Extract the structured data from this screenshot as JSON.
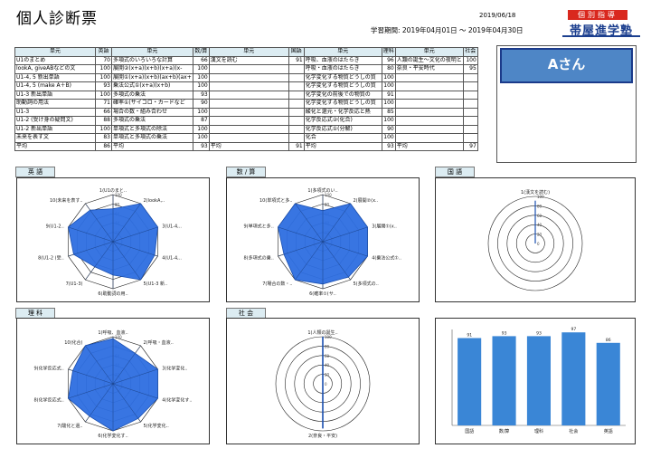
{
  "header": {
    "title": "個人診断票",
    "date": "2019/06/18",
    "period": "学習期間: 2019年04月01日 ～ 2019年04月30日",
    "logo_top": "個別指導",
    "logo_main": "帯屋進学塾"
  },
  "student": {
    "name": "Aさん"
  },
  "table": {
    "headers": [
      "単元",
      "英語",
      "単元",
      "数/算",
      "単元",
      "国語",
      "単元",
      "理科",
      "単元",
      "社会"
    ],
    "rows": [
      [
        "U1のまとめ",
        "70",
        "多項式のいろいろな計算",
        "66",
        "漢文を読む",
        "91",
        "呼吸、血液のはたらき",
        "96",
        "人類の誕生～文化の夜明と",
        "100"
      ],
      [
        "lookA, giveABなどの文",
        "100",
        "展開②(x+a)(x+b)(x+a)(x-",
        "100",
        "",
        "",
        "呼吸・血液のはたらき",
        "80",
        "奈良・平安時代",
        "95"
      ],
      [
        "U1-4, 5 新出単語",
        "100",
        "展開①(x+a)(x+b)(ax+b)(ax+",
        "100",
        "",
        "",
        "化学変化する物質どうしの質",
        "100",
        "",
        ""
      ],
      [
        "U1-4, 5 (make A＋B)",
        "93",
        "乗法公式①(x+a)(x+b)",
        "100",
        "",
        "",
        "化学変化する物質どうしの質",
        "100",
        "",
        ""
      ],
      [
        "U1-3 新出単語",
        "100",
        "多項式の乗法",
        "93",
        "",
        "",
        "化学変化の前後での物質の",
        "91",
        "",
        ""
      ],
      [
        "助動詞の用法",
        "71",
        "確率①(サイコロ・カードなど",
        "90",
        "",
        "",
        "化学変化する物質どうしの質",
        "100",
        "",
        ""
      ],
      [
        "U1-3",
        "66",
        "場合の数・組み合わせ",
        "100",
        "",
        "",
        "酸化と還元・化学反応と熱",
        "85",
        "",
        ""
      ],
      [
        "U1-2 (受け身の疑問文)",
        "88",
        "多項式の乗法",
        "87",
        "",
        "",
        "化学反応式②(化合)",
        "100",
        "",
        ""
      ],
      [
        "U1-2 新出単語",
        "100",
        "単項式と多項式の除法",
        "100",
        "",
        "",
        "化学反応式①(分解)",
        "90",
        "",
        ""
      ],
      [
        "未来を表す文",
        "83",
        "単項式と多項式の乗法",
        "100",
        "",
        "",
        "化合",
        "100",
        "",
        ""
      ]
    ],
    "averages": [
      "平均",
      "86",
      "平均",
      "93",
      "平均",
      "91",
      "平均",
      "93",
      "平均",
      "97"
    ]
  },
  "panels": {
    "english": "英 語",
    "math": "数 / 算",
    "japanese": "国 語",
    "science": "理 科",
    "social": "社 会"
  },
  "radar": {
    "english": {
      "labels": [
        "1(U1のまと..",
        "2(lookA,..",
        "3(U1-4,..",
        "4(U1-4,..",
        "5(U1-3 新..",
        "6(助動詞の用..",
        "7(U1-3)",
        "8(U1-2 (受..",
        "9(U1-2..",
        "10(未来を表す.."
      ],
      "values": [
        70,
        100,
        100,
        93,
        100,
        71,
        66,
        88,
        100,
        83
      ]
    },
    "math": {
      "labels": [
        "1(多項式のい..",
        "2(展開②(x..",
        "3(展開①(x..",
        "4(乗法公式①..",
        "5(多項式の..",
        "6(確率①(サ..",
        "7(場合の数・..",
        "8(多項式の乗..",
        "9(単項式と多..",
        "10(単項式と多.."
      ],
      "values": [
        66,
        100,
        100,
        100,
        93,
        90,
        100,
        87,
        100,
        100
      ]
    },
    "japanese": {
      "labels": [
        "1(漢文を読む)"
      ],
      "values": [
        91
      ]
    },
    "science": {
      "labels": [
        "1(呼吸、血液..",
        "2(呼吸・血液..",
        "3(化学変化..",
        "4(化学変化す..",
        "5(化学変化..",
        "6(化学変化す..",
        "7(酸化と還..",
        "8(化学反応式..",
        "9(化学反応式..",
        "10(化合)"
      ],
      "values": [
        96,
        80,
        100,
        100,
        91,
        100,
        85,
        100,
        90,
        100
      ]
    },
    "social": {
      "labels": [
        "1(人類の誕生..",
        "2(奈良・平安)"
      ],
      "values": [
        100,
        95
      ]
    }
  },
  "chart_data": {
    "type": "bar",
    "categories": [
      "国語",
      "数/算",
      "理科",
      "社会",
      "英語"
    ],
    "values": [
      91,
      93,
      93,
      97,
      86
    ],
    "ylim": [
      0,
      100
    ],
    "color": "#3a86d6"
  },
  "colors": {
    "radar_fill": "#2d6ee0",
    "accent": "#1b3a8a",
    "header_bg": "#dcecf2"
  }
}
